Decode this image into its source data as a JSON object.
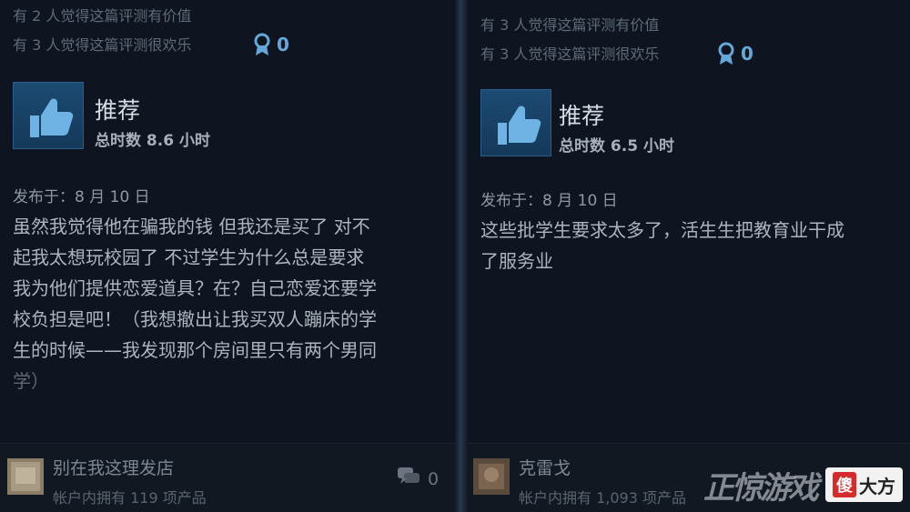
{
  "left_review": {
    "helpful_count_text": "有 2 人觉得这篇评测有价值",
    "funny_count_text": "有 3 人觉得这篇评测很欢乐",
    "award_count": "0",
    "verdict": "推荐",
    "hours": "总时数 8.6 小时",
    "posted": "发布于：8 月 10 日",
    "body_lines": [
      "虽然我觉得他在骗我的钱 但我还是买了 对不",
      "起我太想玩校园了 不过学生为什么总是要求",
      "我为他们提供恋爱道具？在？自己恋爱还要学",
      "校负担是吧！（我想撤出让我买双人蹦床的学",
      "生的时候——我发现那个房间里只有两个男同",
      "学）"
    ],
    "author": "别在我这理发店",
    "products": "帐户内拥有 119 项产品",
    "comment_count": "0"
  },
  "right_review": {
    "helpful_count_text": "有 3 人觉得这篇评测有价值",
    "funny_count_text": "有 3 人觉得这篇评测很欢乐",
    "award_count": "0",
    "verdict": "推荐",
    "hours": "总时数 6.5 小时",
    "posted": "发布于：8 月 10 日",
    "body_lines": [
      "这些批学生要求太多了，活生生把教育业干成",
      "了服务业"
    ],
    "author": "克雷戈",
    "products": "帐户内拥有 1,093 项产品"
  },
  "watermark": {
    "game_text": "正惊游戏",
    "brand_first": "傻",
    "brand_rest": "大方"
  },
  "colors": {
    "background": "#0e1420",
    "accent_blue": "#66a7d8",
    "thumb_blue": "#1c4a71"
  },
  "icons": {
    "award": "award-ribbon-icon",
    "thumb": "thumbs-up-icon",
    "comment": "comment-bubble-icon"
  }
}
